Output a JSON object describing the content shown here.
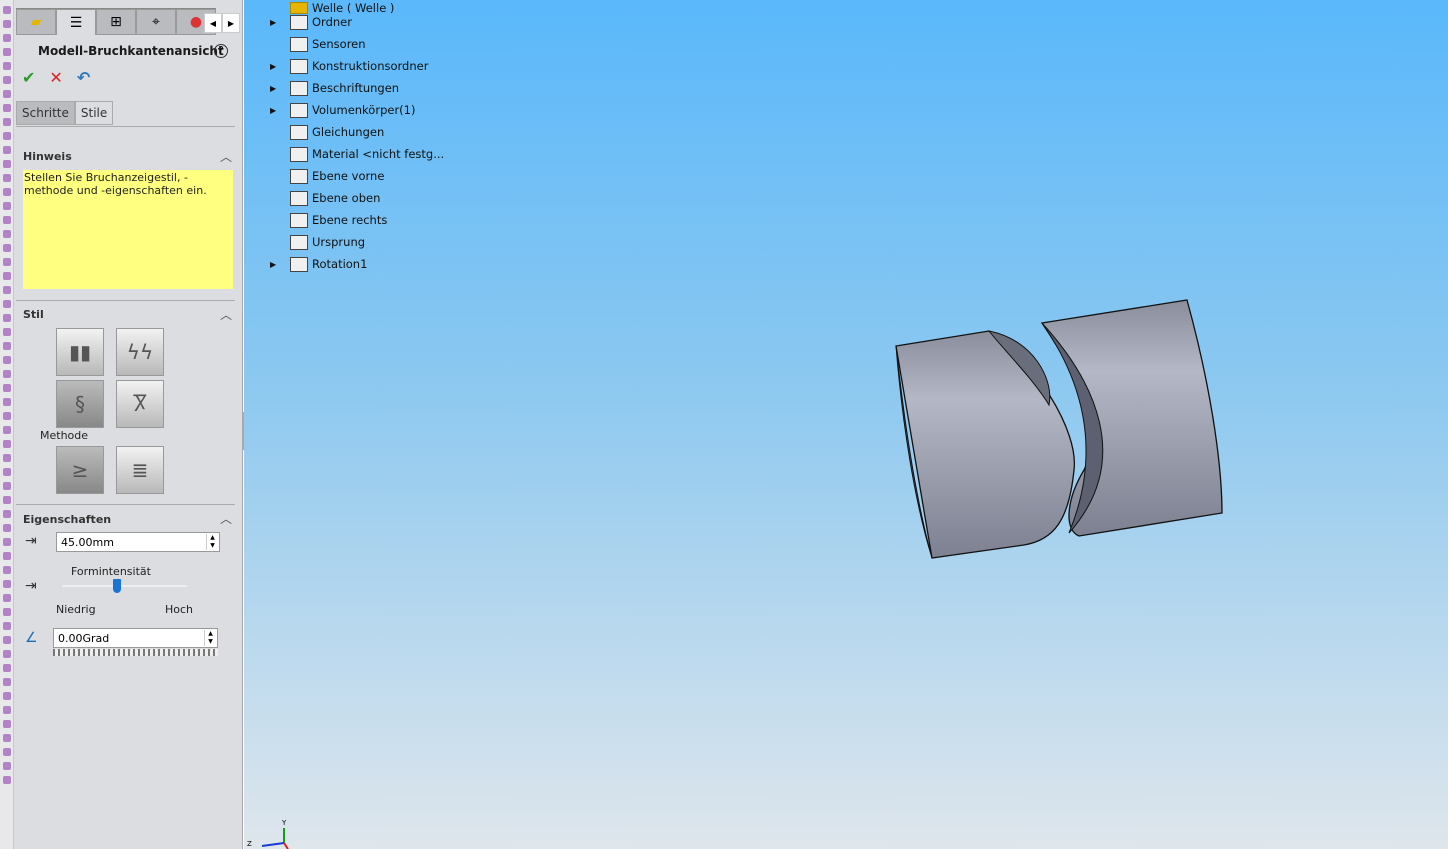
{
  "panel": {
    "title": "Modell-Bruchkantenansicht",
    "help": "?",
    "ok": "✔",
    "cancel": "✕",
    "undo": "↶",
    "subtabs": [
      "Schritte",
      "Stile"
    ],
    "hint_header": "Hinweis",
    "hint_text": "Stellen Sie Bruchanzeigestil, -methode und -eigenschaften ein.",
    "style_header": "Stil",
    "method_label": "Methode",
    "props_header": "Eigenschaften",
    "gap_value": "45.00mm",
    "intensity_label": "Formintensität",
    "intensity_low": "Niedrig",
    "intensity_high": "Hoch",
    "intensity_fraction": 0.44,
    "angle_value": "0.00Grad"
  },
  "tree": {
    "root": "Welle ( Welle )",
    "items": [
      {
        "label": "Ordner",
        "expand": true,
        "icon": "history-folder-icon"
      },
      {
        "label": "Sensoren",
        "expand": false,
        "icon": "sensor-folder-icon"
      },
      {
        "label": "Konstruktionsordner",
        "expand": true,
        "icon": "design-folder-icon"
      },
      {
        "label": "Beschriftungen",
        "expand": true,
        "icon": "annotation-folder-icon"
      },
      {
        "label": "Volumenkörper(1)",
        "expand": true,
        "icon": "solid-bodies-icon"
      },
      {
        "label": "Gleichungen",
        "expand": false,
        "icon": "equations-icon"
      },
      {
        "label": "Material <nicht festg...",
        "expand": false,
        "icon": "material-icon"
      },
      {
        "label": "Ebene vorne",
        "expand": false,
        "icon": "plane-icon"
      },
      {
        "label": "Ebene oben",
        "expand": false,
        "icon": "plane-icon"
      },
      {
        "label": "Ebene rechts",
        "expand": false,
        "icon": "plane-icon"
      },
      {
        "label": "Ursprung",
        "expand": false,
        "icon": "origin-icon"
      },
      {
        "label": "Rotation1",
        "expand": true,
        "icon": "revolve-icon"
      }
    ]
  },
  "triad": {
    "y": "Y",
    "z": "Z"
  }
}
